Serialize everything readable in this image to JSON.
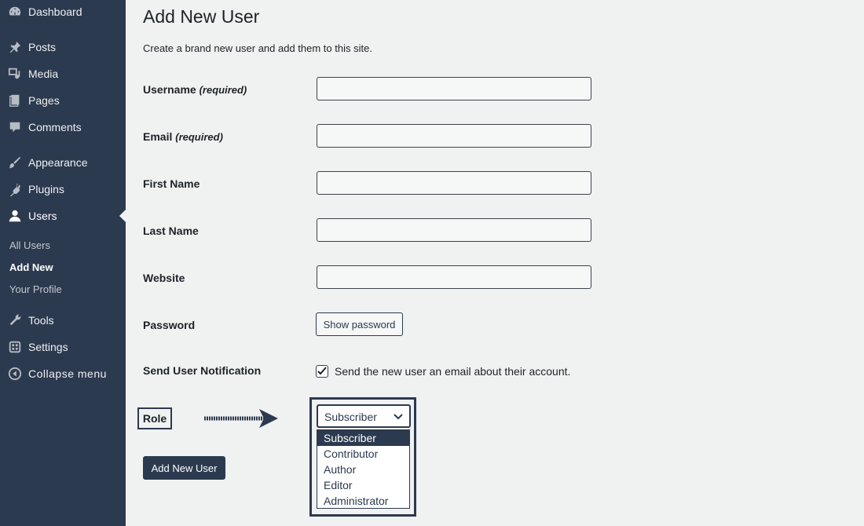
{
  "sidebar": {
    "items": [
      {
        "label": "Dashboard",
        "icon": "dashboard-icon"
      },
      {
        "label": "Posts",
        "icon": "pin-icon"
      },
      {
        "label": "Media",
        "icon": "media-icon"
      },
      {
        "label": "Pages",
        "icon": "pages-icon"
      },
      {
        "label": "Comments",
        "icon": "comments-icon"
      },
      {
        "label": "Appearance",
        "icon": "brush-icon"
      },
      {
        "label": "Plugins",
        "icon": "plug-icon"
      },
      {
        "label": "Users",
        "icon": "user-icon"
      },
      {
        "label": "Tools",
        "icon": "wrench-icon"
      },
      {
        "label": "Settings",
        "icon": "settings-icon"
      }
    ],
    "sub_items": [
      "All Users",
      "Add New",
      "Your Profile"
    ],
    "current_sub": "Add New",
    "collapse_label": "Collapse menu"
  },
  "main": {
    "title": "Add New User",
    "description": "Create a brand new user and add them to this site.",
    "fields": {
      "username": {
        "label": "Username",
        "required": "(required)",
        "value": ""
      },
      "email": {
        "label": "Email",
        "required": "(required)",
        "value": ""
      },
      "first_name": {
        "label": "First Name",
        "value": ""
      },
      "last_name": {
        "label": "Last Name",
        "value": ""
      },
      "website": {
        "label": "Website",
        "value": ""
      }
    },
    "password": {
      "label": "Password",
      "button": "Show password"
    },
    "notification": {
      "label": "Send User Notification",
      "checked": true,
      "text": "Send the new user an email about their account."
    },
    "role": {
      "label": "Role",
      "selected": "Subscriber",
      "options": [
        "Subscriber",
        "Contributor",
        "Author",
        "Editor",
        "Administrator"
      ]
    },
    "submit_label": "Add New User"
  },
  "colors": {
    "sidebar_bg": "#2c3a4f",
    "page_bg": "#f0f1f1",
    "accent": "#2c3a4f"
  }
}
